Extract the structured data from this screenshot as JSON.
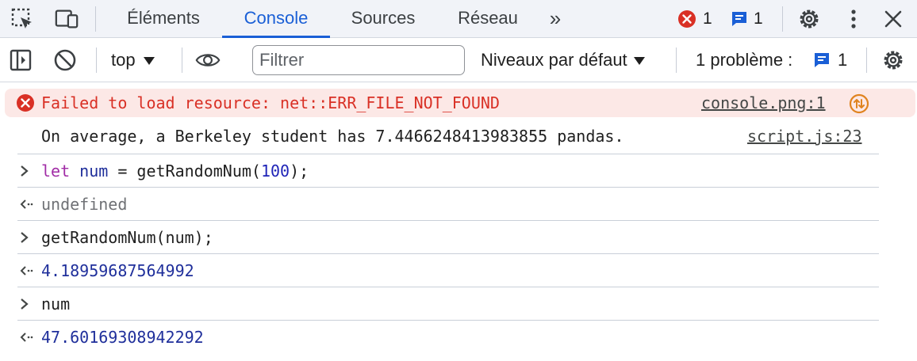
{
  "tabs": {
    "items": [
      {
        "label": "Éléments"
      },
      {
        "label": "Console"
      },
      {
        "label": "Sources"
      },
      {
        "label": "Réseau"
      }
    ],
    "more_label": "»",
    "error_count": "1",
    "message_count": "1"
  },
  "toolbar": {
    "context": "top",
    "filter_placeholder": "Filtrer",
    "levels": "Niveaux par défaut",
    "issues_label": "1 problème :",
    "issues_count": "1"
  },
  "console": {
    "error": {
      "text": "Failed to load resource: net::ERR_FILE_NOT_FOUND",
      "source": "console.png:1"
    },
    "log": {
      "text": "On average, a Berkeley student has 7.4466248413983855 pandas.",
      "source": "script.js:23"
    },
    "entry1": {
      "keyword": "let",
      "var": "num",
      "op": " = getRandomNum(",
      "arg": "100",
      "end": ");"
    },
    "result1": "undefined",
    "entry2": "getRandomNum(num);",
    "result2": "4.18959687564992",
    "entry3": "num",
    "result3": "47.60169308942292"
  },
  "colors": {
    "accent": "#1a5fd6",
    "error_bg": "#fce8e6",
    "error_text": "#d93025",
    "result_number": "#1f2f9b"
  }
}
